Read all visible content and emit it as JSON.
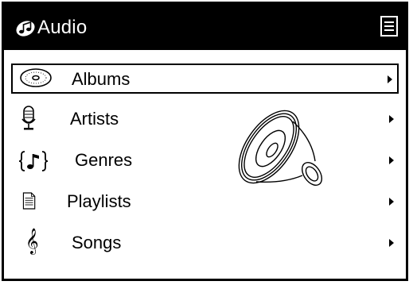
{
  "header": {
    "title": "Audio",
    "logo_icon": "audio-note-icon",
    "menu_icon": "menu-icon"
  },
  "menu": {
    "items": [
      {
        "label": "Albums",
        "icon": "disc-icon",
        "selected": true
      },
      {
        "label": "Artists",
        "icon": "microphone-icon",
        "selected": false
      },
      {
        "label": "Genres",
        "icon": "music-note-braces-icon",
        "selected": false
      },
      {
        "label": "Playlists",
        "icon": "document-icon",
        "selected": false
      },
      {
        "label": "Songs",
        "icon": "treble-clef-icon",
        "selected": false
      }
    ]
  },
  "colors": {
    "foreground": "#000000",
    "background": "#ffffff"
  }
}
